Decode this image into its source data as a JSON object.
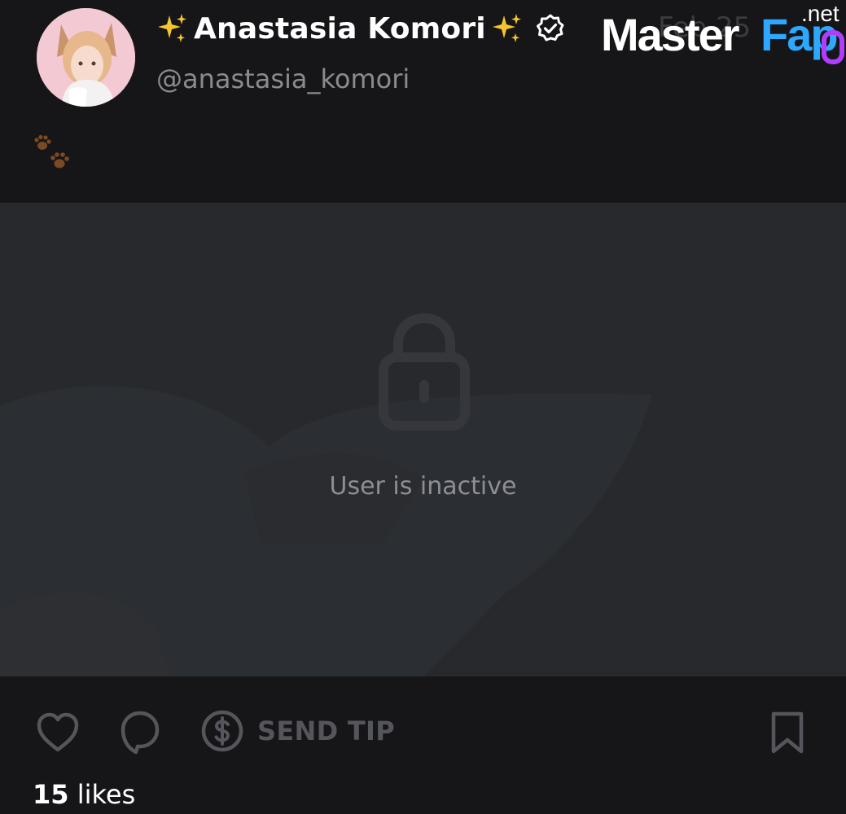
{
  "post": {
    "author_name": "Anastasia Komori",
    "handle": "@anastasia_komori",
    "date": "Feb 25",
    "caption_emoji": "paw-prints",
    "media_status": "User is inactive",
    "likes_count": "15",
    "likes_label": "likes"
  },
  "actions": {
    "send_tip_label": "SEND TIP"
  },
  "watermark": {
    "brand_main": "Master",
    "brand_accent": "Fap",
    "brand_tld": ".net"
  },
  "icons": {
    "author_prefix": "sparkles-icon",
    "author_suffix": "sparkles-icon",
    "verified": "verified-badge-icon",
    "media": "lock-icon",
    "like": "heart-icon",
    "comment": "comment-icon",
    "tip": "dollar-icon",
    "bookmark": "bookmark-icon"
  },
  "colors": {
    "background": "#161618",
    "media_background": "#28292d",
    "primary_text": "#ffffff",
    "secondary_text": "#8a8b91",
    "action_icon": "#55565c",
    "watermark_accent": "#2ea8ff",
    "watermark_accent2": "#b03cff"
  }
}
